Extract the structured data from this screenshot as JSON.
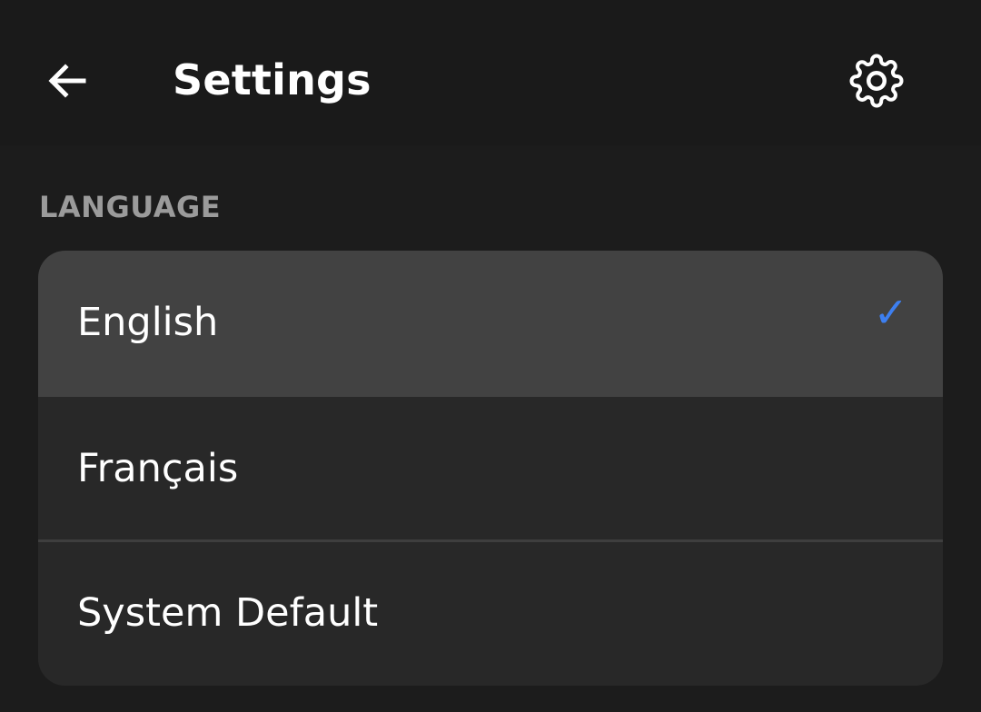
{
  "header": {
    "title": "Settings",
    "back_icon": "arrow-left-icon",
    "settings_icon": "gear-icon"
  },
  "section": {
    "header": "LANGUAGE"
  },
  "languages": {
    "items": [
      {
        "label": "English",
        "selected": true
      },
      {
        "label": "Français",
        "selected": false
      },
      {
        "label": "System Default",
        "selected": false
      }
    ],
    "check_glyph": "✓"
  },
  "colors": {
    "background": "#1c1c1c",
    "app_bar": "#1a1a1a",
    "card": "#282828",
    "selected_row": "#424242",
    "section_header": "#9b9b9b",
    "check": "#3d7ff0"
  }
}
